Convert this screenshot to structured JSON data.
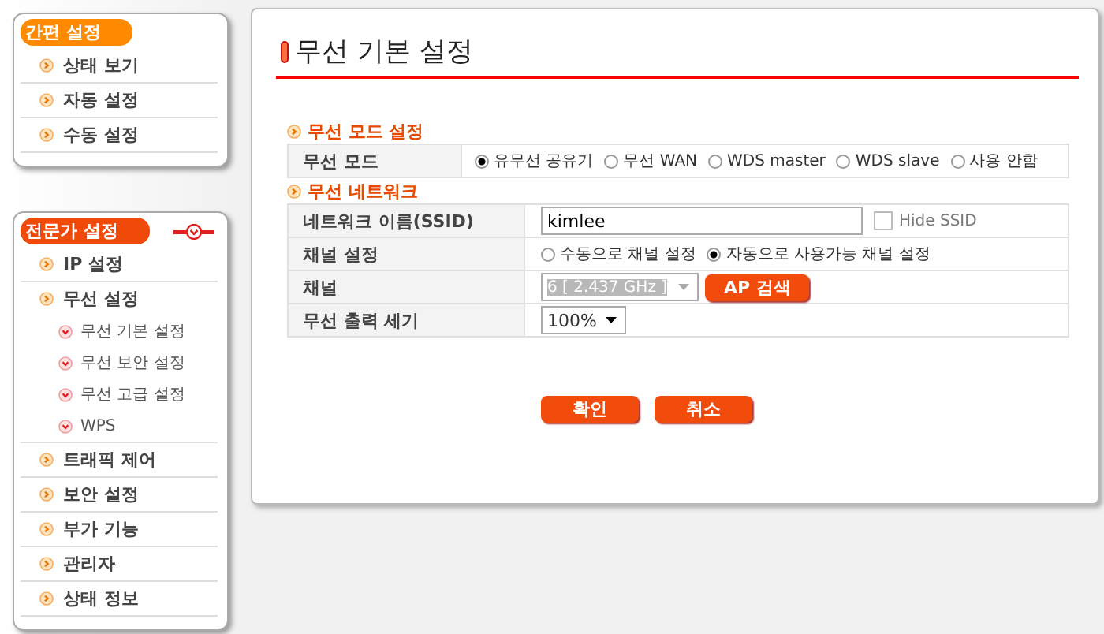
{
  "sidebar": {
    "groups": [
      {
        "title": "간편 설정",
        "collapsible": false,
        "items": [
          {
            "label": "상태 보기"
          },
          {
            "label": "자동 설정"
          },
          {
            "label": "수동 설정"
          }
        ]
      },
      {
        "title": "전문가 설정",
        "collapsible": true,
        "items": [
          {
            "label": "IP 설정"
          },
          {
            "label": "무선 설정",
            "children": [
              {
                "label": "무선 기본 설정"
              },
              {
                "label": "무선 보안 설정"
              },
              {
                "label": "무선 고급 설정"
              },
              {
                "label": "WPS"
              }
            ]
          },
          {
            "label": "트래픽 제어"
          },
          {
            "label": "보안 설정"
          },
          {
            "label": "부가 기능"
          },
          {
            "label": "관리자"
          },
          {
            "label": "상태 정보"
          }
        ]
      }
    ]
  },
  "page_title": "무선 기본 설정",
  "sections": [
    {
      "title": "무선 모드 설정",
      "rows": [
        {
          "label": "무선 모드",
          "kind": "radio",
          "options": [
            {
              "label": "유무선 공유기",
              "selected": true
            },
            {
              "label": "무선 WAN",
              "selected": false
            },
            {
              "label": "WDS master",
              "selected": false
            },
            {
              "label": "WDS slave",
              "selected": false
            },
            {
              "label": "사용 안함",
              "selected": false
            }
          ]
        }
      ]
    },
    {
      "title": "무선 네트워크",
      "rows": [
        {
          "label": "네트워크 이름(SSID)",
          "kind": "text",
          "value": "kimlee",
          "checkbox": {
            "label": "Hide SSID",
            "checked": false
          }
        },
        {
          "label": "채널 설정",
          "kind": "radio",
          "options": [
            {
              "label": "수동으로 채널 설정",
              "selected": false
            },
            {
              "label": "자동으로 사용가능 채널 설정",
              "selected": true
            }
          ]
        },
        {
          "label": "채널",
          "kind": "select",
          "value": "6 [ 2.437 GHz ]",
          "disabled": true,
          "button": "AP 검색"
        },
        {
          "label": "무선 출력 세기",
          "kind": "select",
          "value": "100%",
          "disabled": false
        }
      ]
    }
  ],
  "buttons": [
    "확인",
    "취소"
  ]
}
